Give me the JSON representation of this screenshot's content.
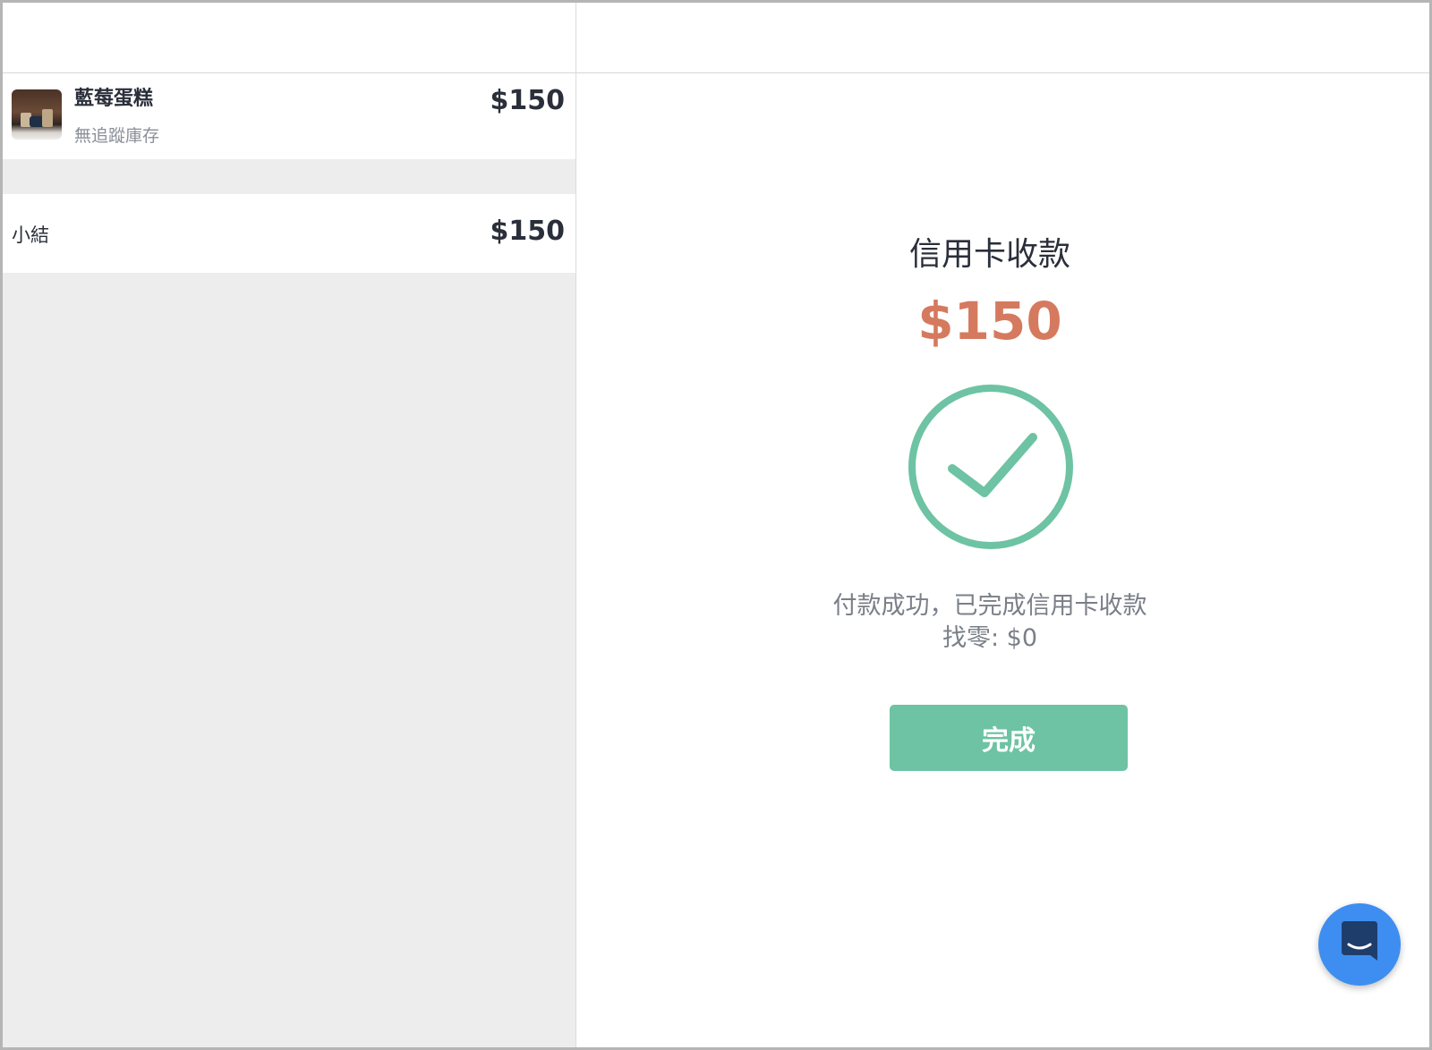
{
  "cart": {
    "items": [
      {
        "name": "藍莓蛋糕",
        "subtitle": "無追蹤庫存",
        "price": "$150",
        "thumbnail_icon": "cake-photo"
      }
    ],
    "subtotal_label": "小結",
    "subtotal_value": "$150"
  },
  "payment": {
    "title": "信用卡收款",
    "amount": "$150",
    "status_icon": "check-circle-icon",
    "message": "付款成功，已完成信用卡收款",
    "change": "找零: $0",
    "done_label": "完成"
  },
  "support": {
    "chat_icon": "chat-bubble-icon"
  },
  "colors": {
    "accent_green": "#6dc3a4",
    "amount_orange": "#d57a5e",
    "chat_blue": "#3d8ef0",
    "panel_grey": "#ededed"
  }
}
